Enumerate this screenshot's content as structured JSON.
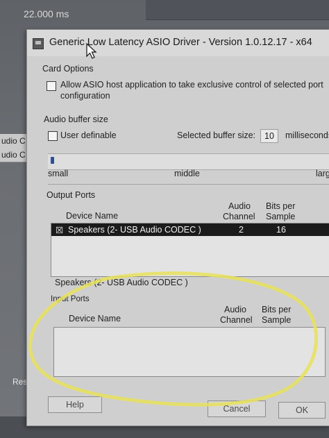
{
  "background": {
    "top_value": "22.000 ms",
    "left_rows": [
      "udio C",
      "udio C"
    ],
    "reset_label": "Reset"
  },
  "dialog": {
    "title": "Generic Low Latency ASIO Driver - Version 1.0.12.17 - x64",
    "card_options": {
      "heading": "Card Options",
      "exclusive_label_line1": "Allow ASIO host application to take exclusive control of selected port",
      "exclusive_label_line2": "configuration",
      "exclusive_checked": false
    },
    "buffer": {
      "heading": "Audio buffer size",
      "user_definable_label": "User definable",
      "user_definable_checked": false,
      "selected_label": "Selected buffer size:",
      "selected_value": "10",
      "unit": "milliseconds",
      "slider_position": 0.0,
      "marks": [
        "small",
        "middle",
        "large"
      ]
    },
    "output_ports": {
      "heading": "Output Ports",
      "col_device": "Device Name",
      "col_channel_line1": "Audio",
      "col_channel_line2": "Channel",
      "col_bits_line1": "Bits per",
      "col_bits_line2": "Sample",
      "rows": [
        {
          "checked_glyph": "☒",
          "name": "Speakers (2- USB Audio CODEC )",
          "channels": "2",
          "bits": "16"
        }
      ],
      "selected_device": "Speakers (2- USB Audio CODEC )"
    },
    "input_ports": {
      "heading": "Input Ports",
      "col_device": "Device Name",
      "col_channel_line1": "Audio",
      "col_channel_line2": "Channel",
      "col_bits_line1": "Bits per",
      "col_bits_line2": "Sample"
    },
    "buttons": {
      "help": "Help",
      "cancel": "Cancel",
      "ok": "OK"
    }
  },
  "annotation_color": "#e8e25a"
}
